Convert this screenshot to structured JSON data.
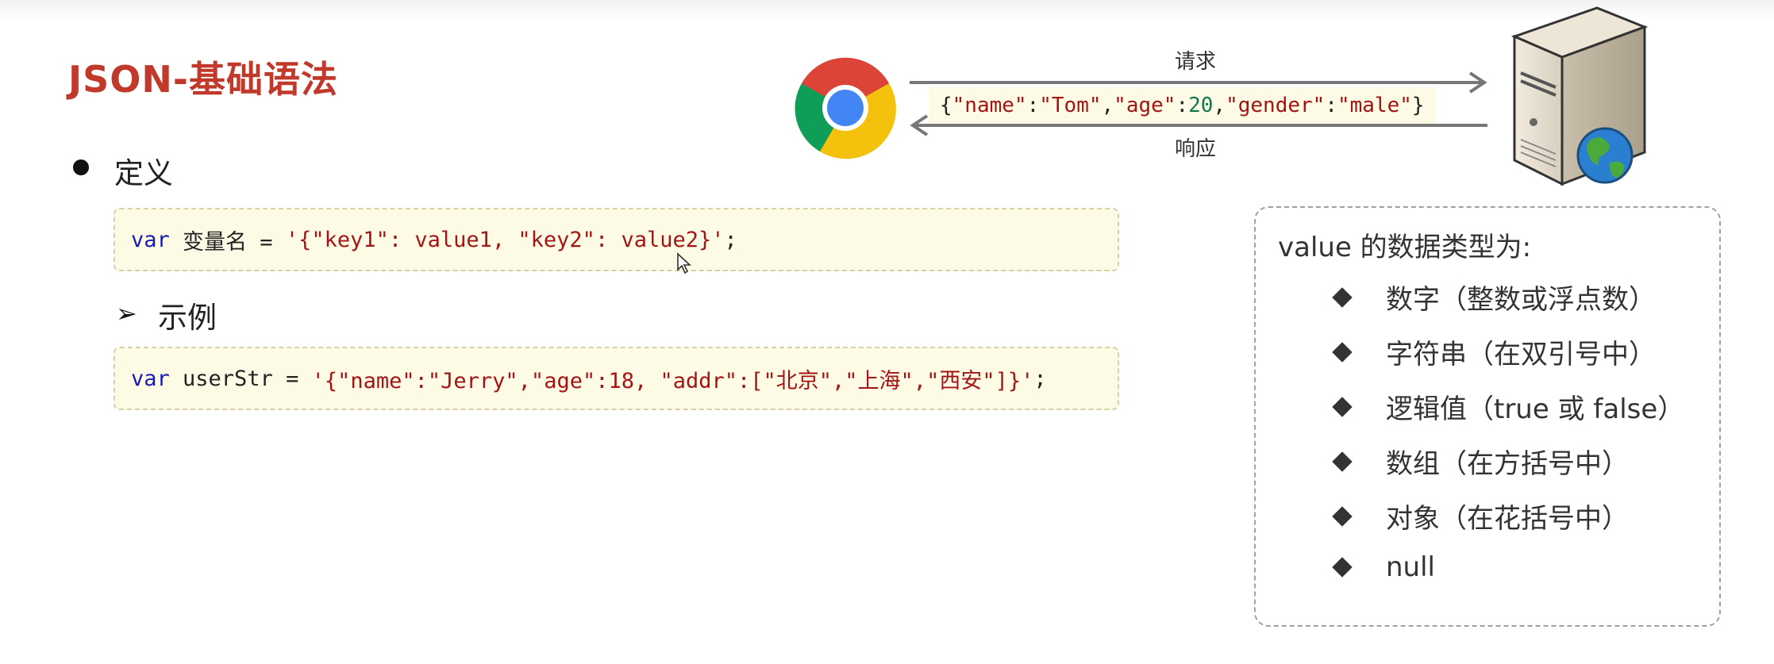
{
  "slide": {
    "title": "JSON-基础语法"
  },
  "definition": {
    "label": "定义",
    "code": {
      "keyword": "var",
      "varname": " 变量名 = ",
      "string": "'{\"key1\": value1, \"key2\": value2}'",
      "end": ";"
    }
  },
  "example": {
    "label": "示例",
    "code": {
      "keyword": "var",
      "varname": " userStr = ",
      "string": "'{\"name\":\"Jerry\",\"age\":18, \"addr\":[\"北京\",\"上海\",\"西安\"]}'",
      "end": ";"
    }
  },
  "diagram": {
    "request_label": "请求",
    "response_label": "响应",
    "json_open": "{",
    "json_key1": "\"name\"",
    "json_colon1": ":",
    "json_val1": "\"Tom\"",
    "json_comma1": ",",
    "json_key2": "\"age\"",
    "json_colon2": ":",
    "json_val2": "20",
    "json_comma2": ",",
    "json_key3": "\"gender\"",
    "json_colon3": ":",
    "json_val3": "\"male\"",
    "json_close": "}",
    "client_icon": "chrome-browser-icon",
    "server_icon": "web-server-icon"
  },
  "value_types": {
    "title": "value 的数据类型为:",
    "items": [
      "数字（整数或浮点数）",
      "字符串（在双引号中）",
      "逻辑值（true 或 false）",
      "数组（在方括号中）",
      "对象（在花括号中）",
      "null"
    ]
  },
  "colors": {
    "title": "#c0392b",
    "keyword": "#1a1ab0",
    "string": "#a31515",
    "number": "#0d7a4e",
    "code_bg": "#fdfbe5"
  }
}
